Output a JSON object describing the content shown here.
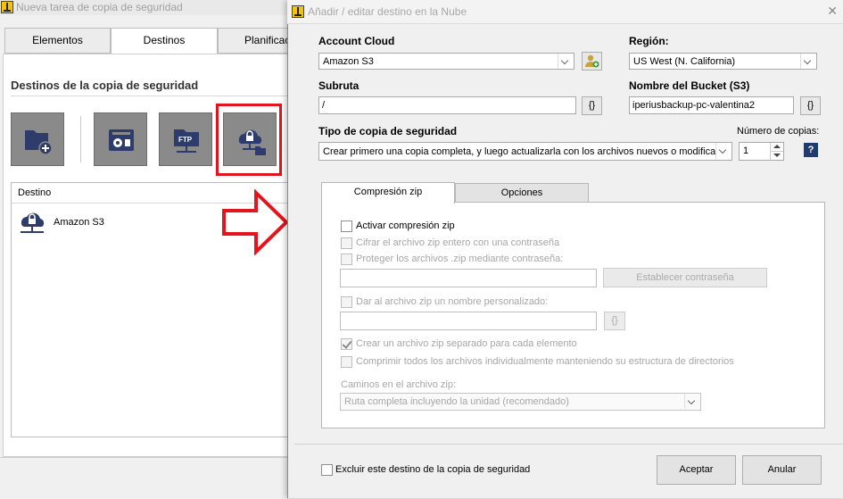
{
  "back_window": {
    "title": "Nueva tarea de copia de seguridad",
    "tabs": [
      "Elementos",
      "Destinos",
      "Planificaci"
    ],
    "active_tab": "Destinos",
    "section_heading": "Destinos de la copia de seguridad",
    "destination_buttons": [
      "folder-add-icon",
      "tape-drive-icon",
      "ftp-server-icon",
      "cloud-folder-icon"
    ],
    "list_header": "Destino",
    "destinations": [
      {
        "icon": "cloud-lock-icon",
        "label": "Amazon S3"
      }
    ],
    "highlight_color": "#e3141b"
  },
  "dialog": {
    "title": "Añadir / editar destino en la Nube",
    "account_cloud": {
      "label": "Account Cloud",
      "value": "Amazon S3"
    },
    "region": {
      "label": "Región:",
      "value": "US West (N. California)"
    },
    "subpath": {
      "label": "Subruta",
      "value": "/",
      "var_button": "{}"
    },
    "bucket": {
      "label": "Nombre del Bucket (S3)",
      "value": "iperiusbackup-pc-valentina2",
      "var_button": "{}"
    },
    "backup_type": {
      "label": "Tipo de copia de seguridad",
      "value": "Crear primero una copia completa, y luego actualizarla con los archivos nuevos o modificados"
    },
    "copies": {
      "label": "Número de copias:",
      "value": "1"
    },
    "help_button": "?",
    "tabs": [
      "Compresión zip",
      "Opciones"
    ],
    "active_tab": "Compresión zip",
    "zip": {
      "enable": "Activar compresión zip",
      "encrypt": "Cifrar el archivo zip entero con una contraseña",
      "protect": "Proteger los archivos .zip mediante contraseña:",
      "password_value": "",
      "set_password_button": "Establecer contraseña",
      "custom_name": "Dar al archivo zip un nombre personalizado:",
      "custom_name_value": "",
      "var_button": "{}",
      "separate": "Crear un archivo zip separado para cada elemento",
      "individually": "Comprimir todos los archivos individualmente manteniendo su estructura de directorios",
      "paths_label": "Caminos en el archivo zip:",
      "paths_value": "Ruta completa incluyendo la unidad (recomendado)"
    },
    "exclude_label": "Excluir este destino de la copia de seguridad",
    "accept_button": "Aceptar",
    "cancel_button": "Anular"
  }
}
